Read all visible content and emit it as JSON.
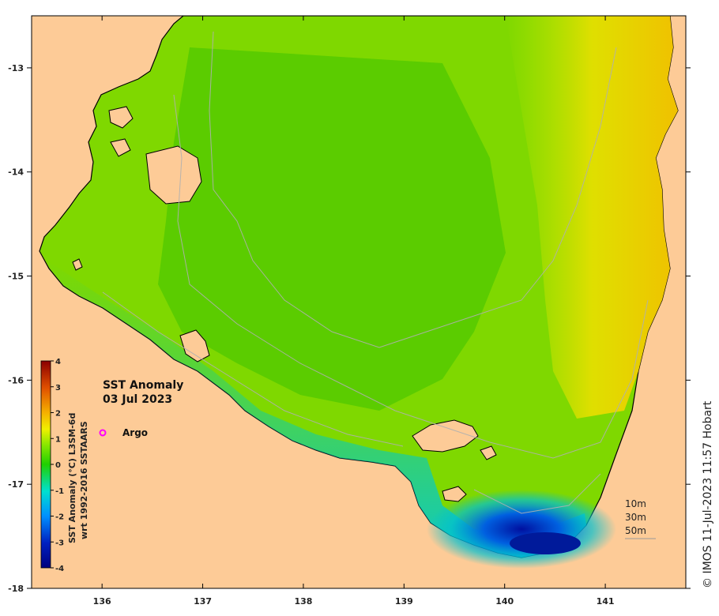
{
  "map": {
    "title": "SST Anomaly",
    "date": "03 Jul 2023",
    "legend": {
      "symbol_color": "#ff00ff",
      "label": "Argo"
    },
    "colorbar": {
      "title_line1": "SST Anomaly (°C) L3SM-6d",
      "title_line2": "wrt 1992-2016 SSTAARS",
      "ticks": [
        "4",
        "3",
        "2",
        "1",
        "0",
        "-1",
        "-2",
        "-3",
        "-4"
      ],
      "range": [
        -4,
        4
      ]
    },
    "depth_contours": [
      "10m",
      "30m",
      "50m"
    ],
    "credit": "© IMOS 11-Jul-2023 11:57 Hobart",
    "x_axis": {
      "ticks": [
        "136",
        "137",
        "138",
        "139",
        "140",
        "141"
      ],
      "range": [
        135.3,
        141.8
      ]
    },
    "y_axis": {
      "ticks": [
        "-13",
        "-14",
        "-15",
        "-16",
        "-17",
        "-18"
      ],
      "range": [
        -18,
        -12.5
      ]
    },
    "colors": {
      "land": "#fdcb97",
      "ocean_base": "#8fe000",
      "coast_line": "#000000",
      "cold": "#0010a0",
      "warm": "#f2d000"
    }
  }
}
